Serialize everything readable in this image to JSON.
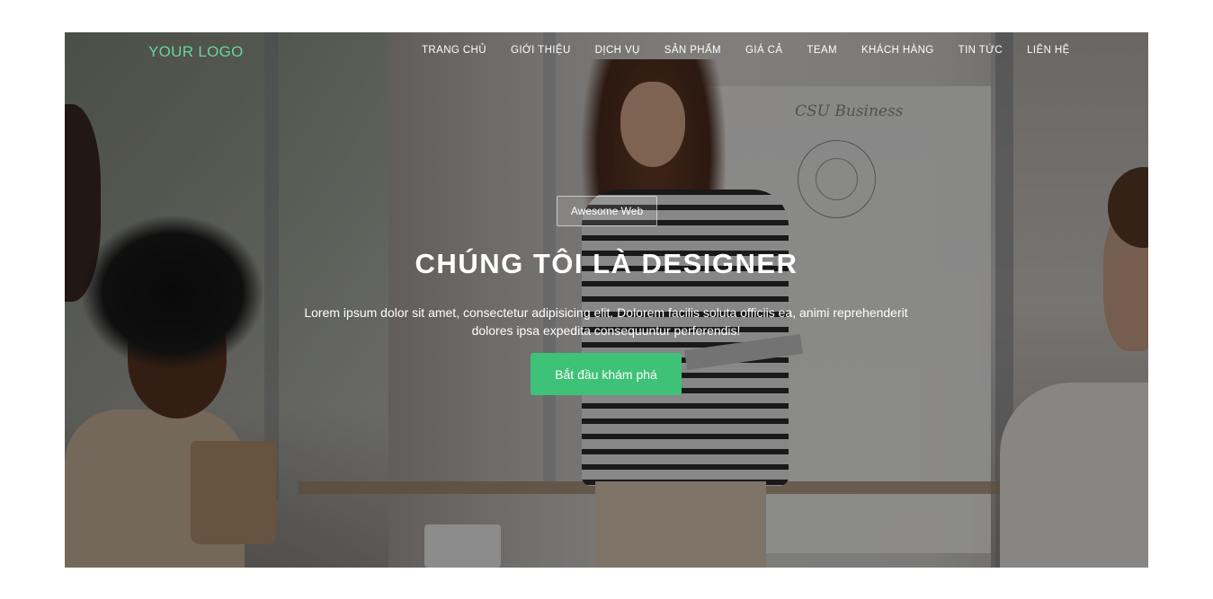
{
  "header": {
    "logo": "YOUR LOGO",
    "nav": [
      {
        "label": "TRANG CHỦ"
      },
      {
        "label": "GIỚI THIỆU"
      },
      {
        "label": "DỊCH VỤ"
      },
      {
        "label": "SẢN PHẨM"
      },
      {
        "label": "GIÁ CẢ"
      },
      {
        "label": "TEAM"
      },
      {
        "label": "KHÁCH HÀNG"
      },
      {
        "label": "TIN TỨC"
      },
      {
        "label": "LIÊN HỆ"
      }
    ]
  },
  "hero": {
    "badge": "Awesome Web",
    "title": "CHÚNG TÔI LÀ DESIGNER",
    "description": "Lorem ipsum dolor sit amet, consectetur adipisicing elit. Dolorem facilis soluta officiis ea, animi reprehenderit dolores ipsa expedita consequuntur perferendis!",
    "cta_label": "Bắt đầu khám phá",
    "board_text": "CSU Business"
  },
  "colors": {
    "logo": "#69d49a",
    "cta": "#3ec277",
    "overlay": "rgba(0,0,0,0.42)"
  }
}
